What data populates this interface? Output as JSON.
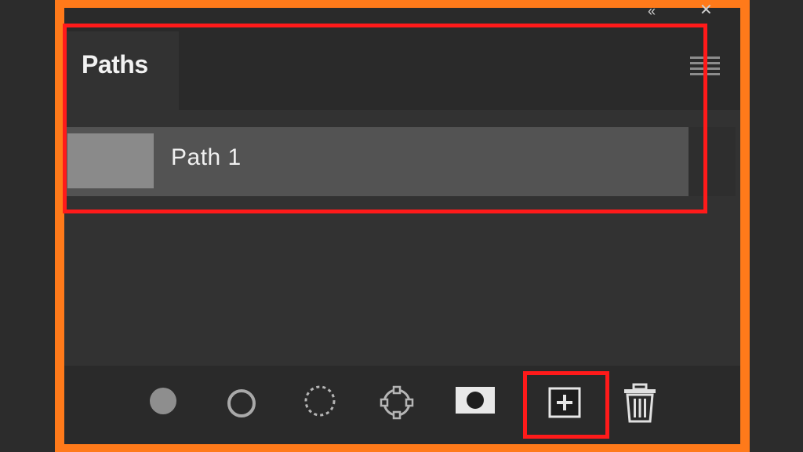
{
  "panel": {
    "tab_label": "Paths",
    "collapse_icon": "double-chevron-icon",
    "close_icon": "close-icon",
    "menu_icon": "panel-menu-icon"
  },
  "paths": [
    {
      "name": "Path 1",
      "selected": true
    }
  ],
  "toolbar": {
    "tools": [
      {
        "name": "fill-path-icon"
      },
      {
        "name": "stroke-path-icon"
      },
      {
        "name": "load-path-as-selection-icon"
      },
      {
        "name": "make-work-path-icon"
      },
      {
        "name": "add-mask-icon"
      },
      {
        "name": "create-new-path-icon"
      },
      {
        "name": "delete-path-icon"
      }
    ]
  },
  "colors": {
    "frame": "#ff7a1a",
    "highlight": "#ff1a1a",
    "panel_bg": "#323232",
    "row_selected": "#535353"
  }
}
